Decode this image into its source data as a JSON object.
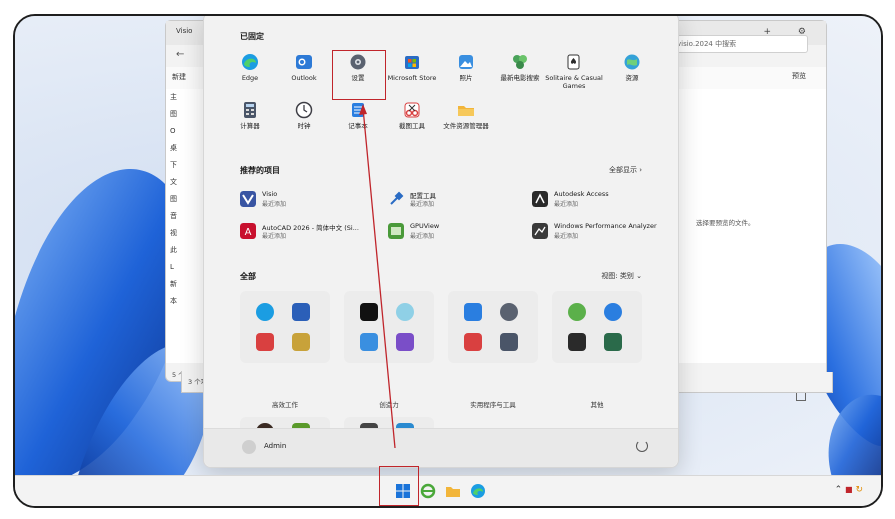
{
  "colors": {
    "accent_red": "#c0252b",
    "start_bg": "#f2f2f2",
    "taskbar_bg": "#f3f3f3"
  },
  "explorer": {
    "tab_title": "Visio",
    "back": "←",
    "new_label": "新建",
    "search_placeholder": "visio.2024 中搜索",
    "preview_label": "预览",
    "no_preview": "选择要预览的文件。",
    "status": "5 个项目",
    "status2": "3 个项",
    "win_controls": "+  ⚙",
    "side_items": [
      "主",
      "图",
      "O",
      "桌",
      "下",
      "文",
      "图",
      "音",
      "视",
      "此",
      "L",
      "新",
      "本"
    ]
  },
  "start": {
    "pinned_title": "已固定",
    "pinned": [
      {
        "label": "Edge",
        "icon": "edge-icon",
        "color": "#1b9de2"
      },
      {
        "label": "Outlook",
        "icon": "outlook-icon",
        "color": "#2d7ad6"
      },
      {
        "label": "设置",
        "icon": "gear-icon",
        "color": "#5a6270"
      },
      {
        "label": "Microsoft Store",
        "icon": "store-icon",
        "color": "#2b6cc4"
      },
      {
        "label": "照片",
        "icon": "photos-icon",
        "color": "#3a8fe0"
      },
      {
        "label": "最新电影搜索",
        "icon": "movie-icon",
        "color": "#4aa35a"
      },
      {
        "label": "Solitaire & Casual Games",
        "icon": "cards-icon",
        "color": "#2b2b2b"
      },
      {
        "label": "资源",
        "icon": "globe-icon",
        "color": "#34a2d8"
      },
      {
        "label": "计算器",
        "icon": "calculator-icon",
        "color": "#4a5568"
      },
      {
        "label": "时钟",
        "icon": "clock-icon",
        "color": "#3f3f46"
      },
      {
        "label": "记事本",
        "icon": "notepad-icon",
        "color": "#2a7ee0"
      },
      {
        "label": "截图工具",
        "icon": "snipping-icon",
        "color": "#d94040"
      },
      {
        "label": "文件资源管理器",
        "icon": "folder-icon",
        "color": "#f2b53a"
      }
    ],
    "recommended_title": "推荐的项目",
    "show_all": "全部显示 ›",
    "recommended": [
      {
        "name": "Visio",
        "sub": "最近添加",
        "icon": "visio-icon",
        "color": "#3955a3"
      },
      {
        "name": "配置工具",
        "sub": "最近添加",
        "icon": "tools-icon",
        "color": "#2b6cc4"
      },
      {
        "name": "Autodesk Access",
        "sub": "最近添加",
        "icon": "autodesk-icon",
        "color": "#2a2a2a"
      },
      {
        "name": "AutoCAD 2026 - 简体中文 (Si...",
        "sub": "最近添加",
        "icon": "autocad-icon",
        "color": "#c8102e"
      },
      {
        "name": "GPUView",
        "sub": "最近添加",
        "icon": "gpuview-icon",
        "color": "#4a9a3a"
      },
      {
        "name": "Windows Performance Analyzer",
        "sub": "最近添加",
        "icon": "wpa-icon",
        "color": "#3a3a3a"
      }
    ],
    "all_title": "全部",
    "view_label": "视图: 类别  ⌄",
    "groups": [
      {
        "label": "高效工作"
      },
      {
        "label": "创造力"
      },
      {
        "label": "实用程序与工具"
      },
      {
        "label": "其他"
      }
    ],
    "user": "Admin"
  }
}
